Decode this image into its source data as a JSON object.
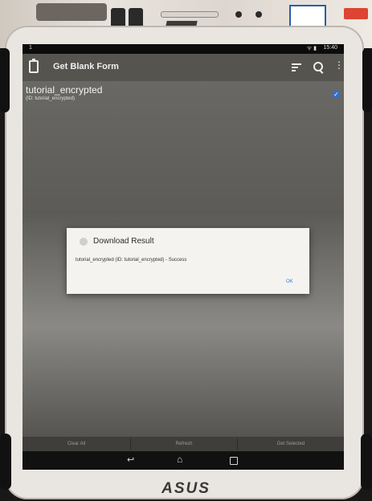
{
  "status_bar": {
    "left": "1",
    "icons": "ᯤ ▮",
    "time": "15:40"
  },
  "app_bar": {
    "title": "Get Blank Form"
  },
  "form_list": [
    {
      "name": "tutorial_encrypted",
      "id": "(ID: tutorial_encrypted)",
      "checked": true
    }
  ],
  "dialog": {
    "title": "Download Result",
    "message": "tutorial_encrypted (ID: tutorial_encrypted) - Success",
    "ok_label": "OK"
  },
  "bottom_buttons": {
    "clear_all": "Clear All",
    "refresh": "Refresh",
    "get_selected": "Get Selected"
  },
  "nav": {
    "back": "↩",
    "home": "⌂"
  },
  "device": {
    "brand": "ASUS"
  },
  "colors": {
    "app_bar": "#55544f",
    "checkbox": "#2e6fd1",
    "dialog_ok": "#3c7ac9"
  }
}
